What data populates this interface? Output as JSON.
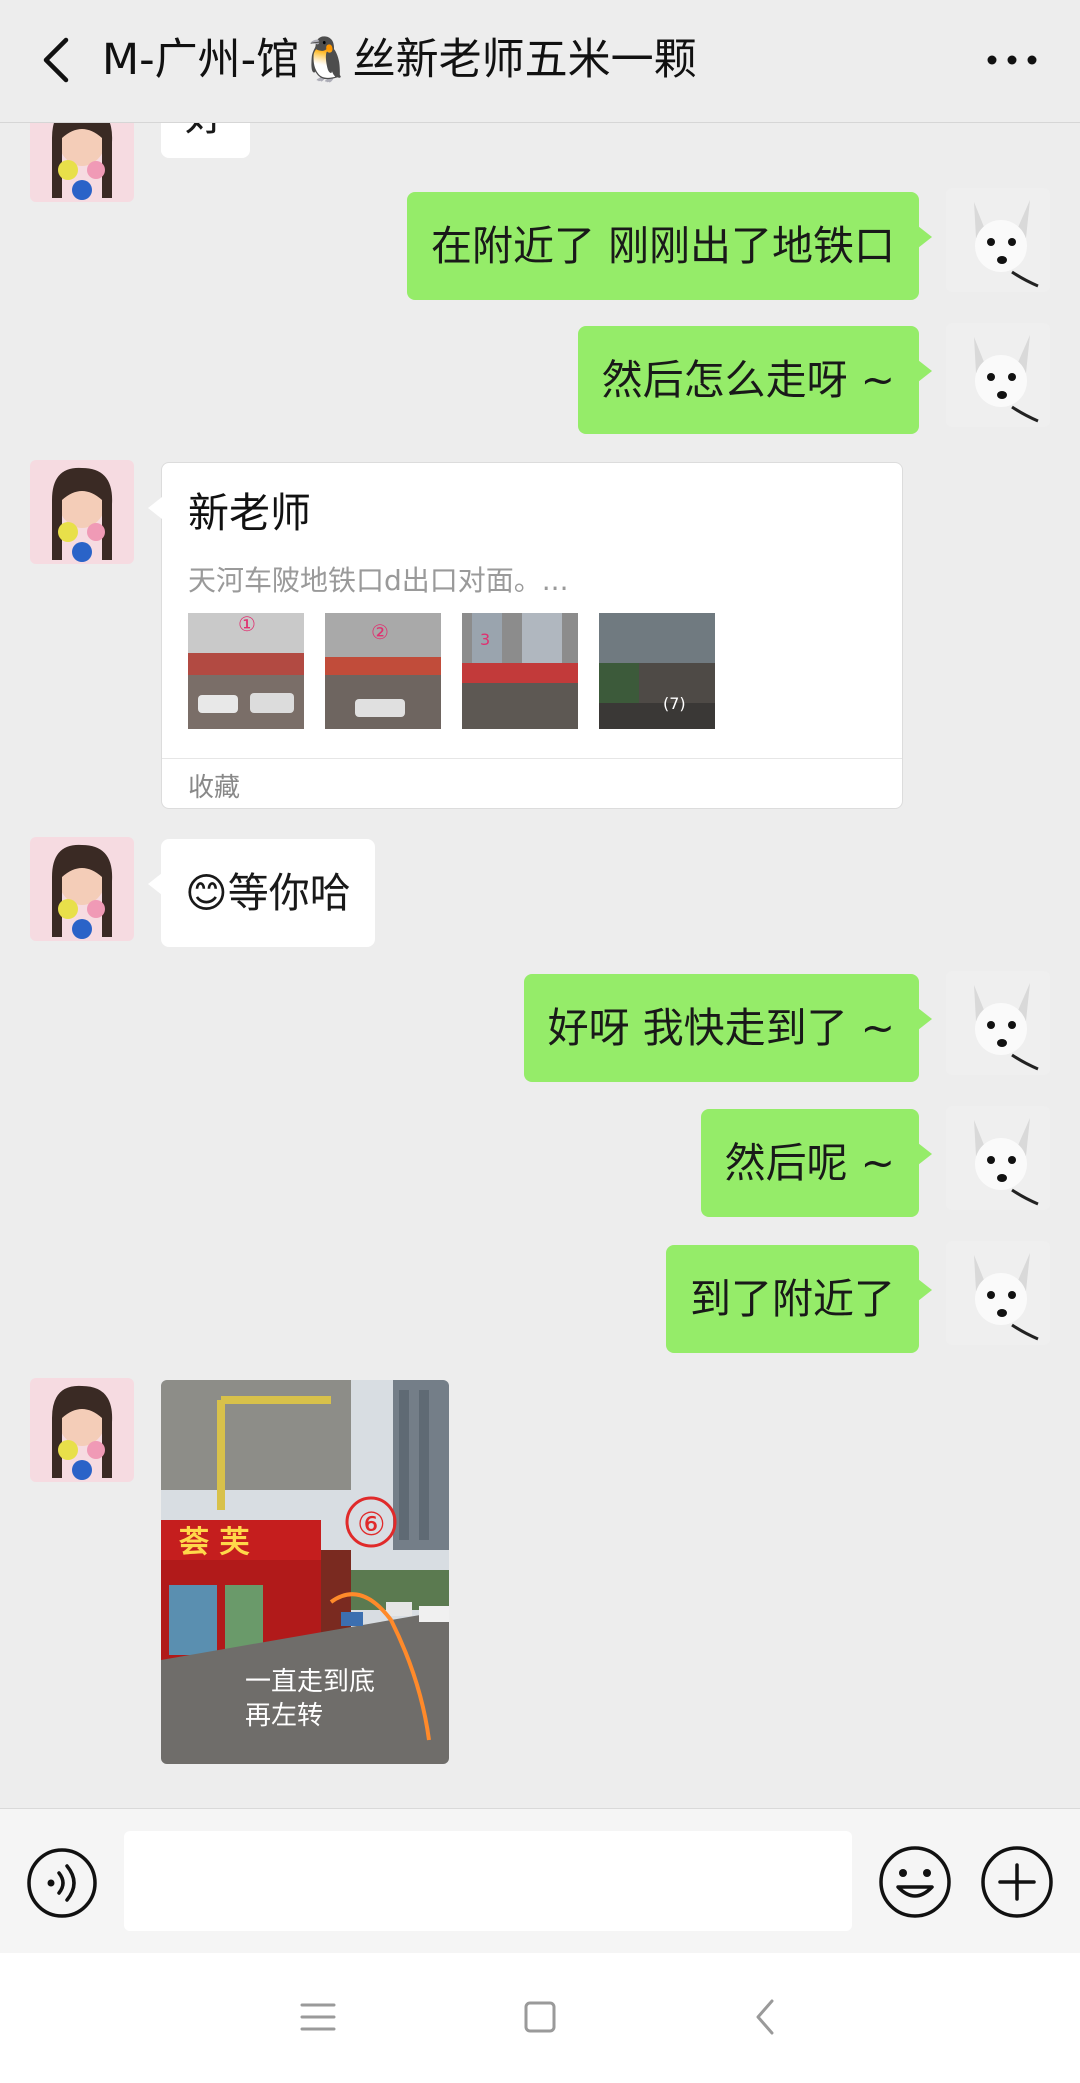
{
  "header": {
    "title": "M-广州-馆🐧丝新老师五米一颗"
  },
  "messages": {
    "partial_in": "好",
    "out1": "在附近了 刚刚出了地铁口",
    "out2": "然后怎么走呀 ~",
    "card": {
      "title": "新老师",
      "desc": "天河车陂地铁口d出口对面。...",
      "thumb_labels": [
        "①",
        "②",
        "3",
        "(7)"
      ],
      "footer": "收藏"
    },
    "in_wait": "😊等你哈",
    "out3": "好呀 我快走到了 ~",
    "out4": "然后呢 ~",
    "out5": "到了附近了",
    "photo": {
      "badge": "⑥",
      "sign": "荟 芙",
      "caption_line1": "一直走到底",
      "caption_line2": "再左转"
    }
  },
  "input": {
    "placeholder": ""
  },
  "colors": {
    "outgoing_bubble": "#95ec69",
    "incoming_bubble": "#ffffff",
    "background": "#ededed"
  },
  "icons": [
    "back-arrow-icon",
    "more-icon",
    "voice-icon",
    "emoji-icon",
    "plus-icon",
    "nav-menu-icon",
    "nav-home-icon",
    "nav-back-icon"
  ]
}
